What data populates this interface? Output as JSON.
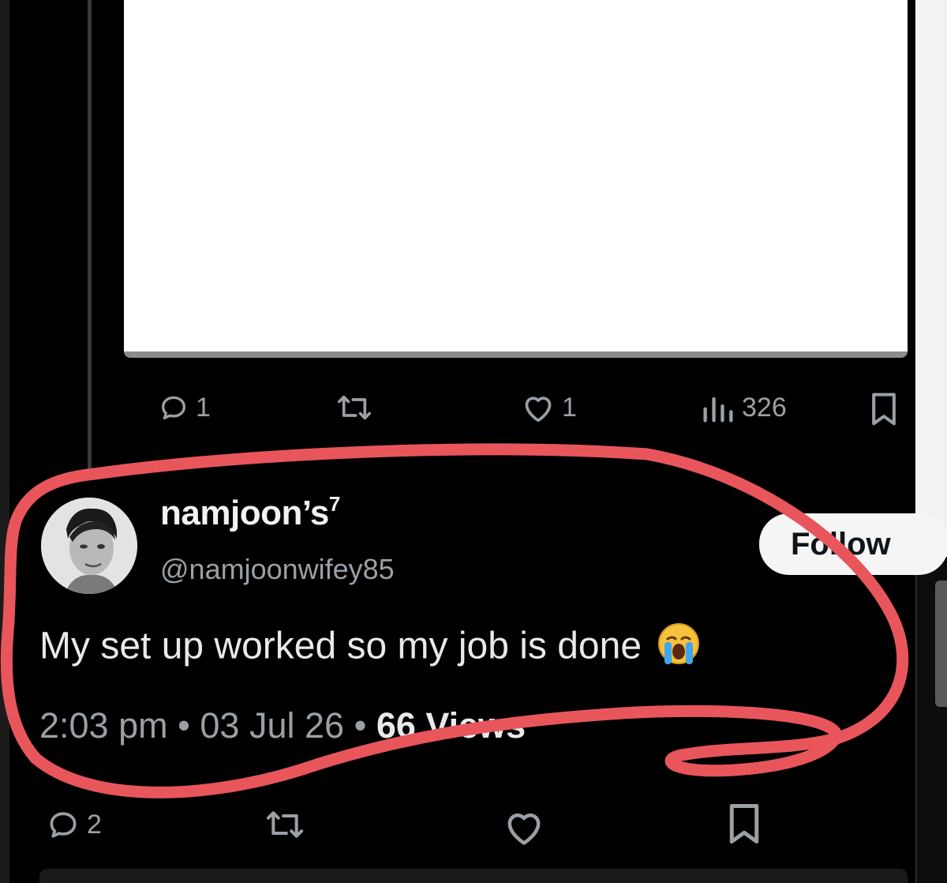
{
  "upper_post": {
    "reply_count": "1",
    "like_count": "1",
    "view_count": "326"
  },
  "post": {
    "display_name": "namjoon’s",
    "display_name_superscript": "7",
    "handle": "@namjoonwifey85",
    "follow_label": "Follow",
    "text": "My set up worked so my job is done",
    "emoji": "😭",
    "time": "2:03 pm",
    "separator": "•",
    "date": "03 Jul 26",
    "views": "66 Views",
    "reply_count": "2"
  },
  "colors": {
    "background": "#000000",
    "annotation_stroke": "#e8565c",
    "muted_text": "#9aa0a6",
    "follow_bg": "#f5f5f5"
  },
  "icons": [
    "reply-icon",
    "repost-icon",
    "like-icon",
    "views-icon",
    "bookmark-icon",
    "crying-face-emoji"
  ]
}
